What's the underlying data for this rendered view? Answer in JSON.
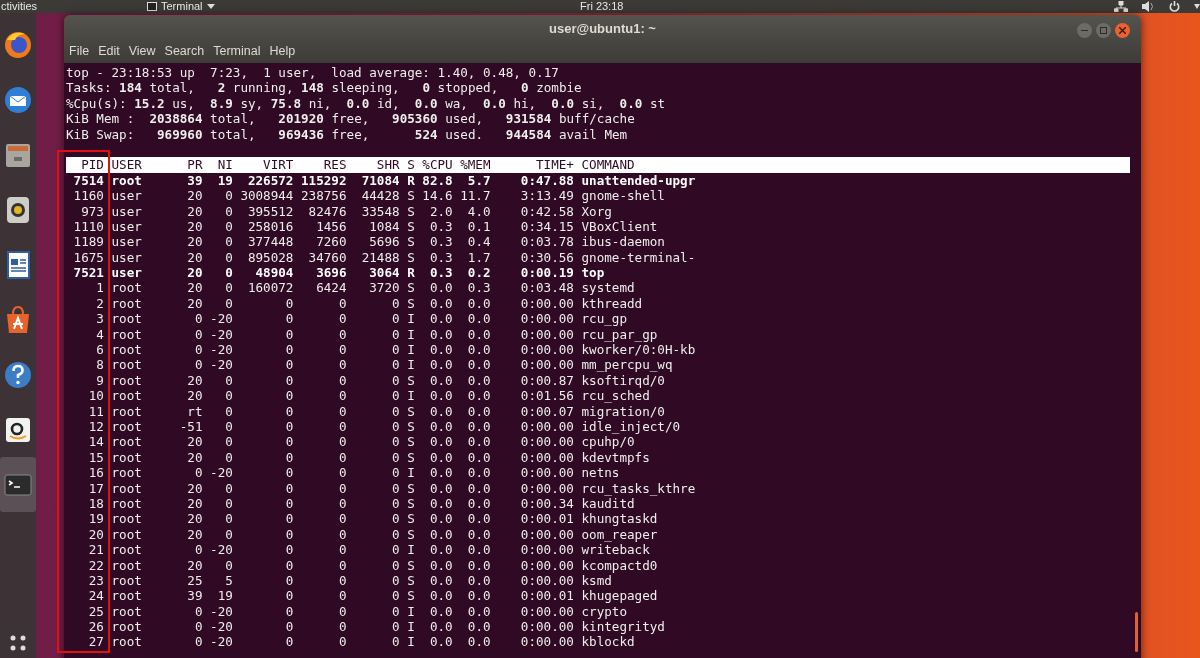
{
  "top_bar": {
    "activities": "ctivities",
    "app_menu": "Terminal",
    "clock": "Fri 23:18"
  },
  "dock": {
    "items": [
      {
        "kind": "browser",
        "selected": false
      },
      {
        "kind": "mail",
        "selected": false
      },
      {
        "kind": "files",
        "selected": false
      },
      {
        "kind": "music",
        "selected": false
      },
      {
        "kind": "writer",
        "selected": false
      },
      {
        "kind": "store",
        "selected": false
      },
      {
        "kind": "help",
        "selected": false
      },
      {
        "kind": "shop",
        "selected": false
      },
      {
        "kind": "terminal",
        "selected": true
      }
    ]
  },
  "window": {
    "title": "user@ubuntu1: ~",
    "menu": [
      "File",
      "Edit",
      "View",
      "Search",
      "Terminal",
      "Help"
    ]
  },
  "summary": [
    "top - 23:18:53 up  7:23,  1 user,  load average: 1.40, 0.48, 0.17",
    "Tasks: **184** total,   **2** running, **148** sleeping,   **0** stopped,   **0** zombie",
    "%Cpu(s): **15.2** us,  **8.9** sy, **75.8** ni,  **0.0** id,  **0.0** wa,  **0.0** hi,  **0.0** si,  **0.0** st",
    "KiB Mem :  **2038864** total,   **201920** free,   **905360** used,   **931584** buff/cache",
    "KiB Swap:   **969960** total,   **969436** free,      **524** used.   **944584** avail Mem"
  ],
  "table": {
    "columns": [
      "PID",
      "USER",
      "PR",
      "NI",
      "VIRT",
      "RES",
      "SHR",
      "S",
      "%CPU",
      "%MEM",
      "TIME+",
      "COMMAND"
    ],
    "rows": [
      {
        "highlighted": true,
        "cells": [
          "7514",
          "root",
          "39",
          "19",
          "226572",
          "115292",
          "71084",
          "R",
          "82.8",
          "5.7",
          "0:47.88",
          "unattended-upgr"
        ]
      },
      {
        "highlighted": false,
        "cells": [
          "1160",
          "user",
          "20",
          "0",
          "3008944",
          "238756",
          "44428",
          "S",
          "14.6",
          "11.7",
          "3:13.49",
          "gnome-shell"
        ]
      },
      {
        "highlighted": false,
        "cells": [
          "973",
          "user",
          "20",
          "0",
          "395512",
          "82476",
          "33548",
          "S",
          "2.0",
          "4.0",
          "0:42.58",
          "Xorg"
        ]
      },
      {
        "highlighted": false,
        "cells": [
          "1110",
          "user",
          "20",
          "0",
          "258016",
          "1456",
          "1084",
          "S",
          "0.3",
          "0.1",
          "0:34.15",
          "VBoxClient"
        ]
      },
      {
        "highlighted": false,
        "cells": [
          "1189",
          "user",
          "20",
          "0",
          "377448",
          "7260",
          "5696",
          "S",
          "0.3",
          "0.4",
          "0:03.78",
          "ibus-daemon"
        ]
      },
      {
        "highlighted": false,
        "cells": [
          "1675",
          "user",
          "20",
          "0",
          "895028",
          "34760",
          "21488",
          "S",
          "0.3",
          "1.7",
          "0:30.56",
          "gnome-terminal-"
        ]
      },
      {
        "highlighted": true,
        "cells": [
          "7521",
          "user",
          "20",
          "0",
          "48904",
          "3696",
          "3064",
          "R",
          "0.3",
          "0.2",
          "0:00.19",
          "top"
        ]
      },
      {
        "highlighted": false,
        "cells": [
          "1",
          "root",
          "20",
          "0",
          "160072",
          "6424",
          "3720",
          "S",
          "0.0",
          "0.3",
          "0:03.48",
          "systemd"
        ]
      },
      {
        "highlighted": false,
        "cells": [
          "2",
          "root",
          "20",
          "0",
          "0",
          "0",
          "0",
          "S",
          "0.0",
          "0.0",
          "0:00.00",
          "kthreadd"
        ]
      },
      {
        "highlighted": false,
        "cells": [
          "3",
          "root",
          "0",
          "-20",
          "0",
          "0",
          "0",
          "I",
          "0.0",
          "0.0",
          "0:00.00",
          "rcu_gp"
        ]
      },
      {
        "highlighted": false,
        "cells": [
          "4",
          "root",
          "0",
          "-20",
          "0",
          "0",
          "0",
          "I",
          "0.0",
          "0.0",
          "0:00.00",
          "rcu_par_gp"
        ]
      },
      {
        "highlighted": false,
        "cells": [
          "6",
          "root",
          "0",
          "-20",
          "0",
          "0",
          "0",
          "I",
          "0.0",
          "0.0",
          "0:00.00",
          "kworker/0:0H-kb"
        ]
      },
      {
        "highlighted": false,
        "cells": [
          "8",
          "root",
          "0",
          "-20",
          "0",
          "0",
          "0",
          "I",
          "0.0",
          "0.0",
          "0:00.00",
          "mm_percpu_wq"
        ]
      },
      {
        "highlighted": false,
        "cells": [
          "9",
          "root",
          "20",
          "0",
          "0",
          "0",
          "0",
          "S",
          "0.0",
          "0.0",
          "0:00.87",
          "ksoftirqd/0"
        ]
      },
      {
        "highlighted": false,
        "cells": [
          "10",
          "root",
          "20",
          "0",
          "0",
          "0",
          "0",
          "I",
          "0.0",
          "0.0",
          "0:01.56",
          "rcu_sched"
        ]
      },
      {
        "highlighted": false,
        "cells": [
          "11",
          "root",
          "rt",
          "0",
          "0",
          "0",
          "0",
          "S",
          "0.0",
          "0.0",
          "0:00.07",
          "migration/0"
        ]
      },
      {
        "highlighted": false,
        "cells": [
          "12",
          "root",
          "-51",
          "0",
          "0",
          "0",
          "0",
          "S",
          "0.0",
          "0.0",
          "0:00.00",
          "idle_inject/0"
        ]
      },
      {
        "highlighted": false,
        "cells": [
          "14",
          "root",
          "20",
          "0",
          "0",
          "0",
          "0",
          "S",
          "0.0",
          "0.0",
          "0:00.00",
          "cpuhp/0"
        ]
      },
      {
        "highlighted": false,
        "cells": [
          "15",
          "root",
          "20",
          "0",
          "0",
          "0",
          "0",
          "S",
          "0.0",
          "0.0",
          "0:00.00",
          "kdevtmpfs"
        ]
      },
      {
        "highlighted": false,
        "cells": [
          "16",
          "root",
          "0",
          "-20",
          "0",
          "0",
          "0",
          "I",
          "0.0",
          "0.0",
          "0:00.00",
          "netns"
        ]
      },
      {
        "highlighted": false,
        "cells": [
          "17",
          "root",
          "20",
          "0",
          "0",
          "0",
          "0",
          "S",
          "0.0",
          "0.0",
          "0:00.00",
          "rcu_tasks_kthre"
        ]
      },
      {
        "highlighted": false,
        "cells": [
          "18",
          "root",
          "20",
          "0",
          "0",
          "0",
          "0",
          "S",
          "0.0",
          "0.0",
          "0:00.34",
          "kauditd"
        ]
      },
      {
        "highlighted": false,
        "cells": [
          "19",
          "root",
          "20",
          "0",
          "0",
          "0",
          "0",
          "S",
          "0.0",
          "0.0",
          "0:00.01",
          "khungtaskd"
        ]
      },
      {
        "highlighted": false,
        "cells": [
          "20",
          "root",
          "20",
          "0",
          "0",
          "0",
          "0",
          "S",
          "0.0",
          "0.0",
          "0:00.00",
          "oom_reaper"
        ]
      },
      {
        "highlighted": false,
        "cells": [
          "21",
          "root",
          "0",
          "-20",
          "0",
          "0",
          "0",
          "I",
          "0.0",
          "0.0",
          "0:00.00",
          "writeback"
        ]
      },
      {
        "highlighted": false,
        "cells": [
          "22",
          "root",
          "20",
          "0",
          "0",
          "0",
          "0",
          "S",
          "0.0",
          "0.0",
          "0:00.00",
          "kcompactd0"
        ]
      },
      {
        "highlighted": false,
        "cells": [
          "23",
          "root",
          "25",
          "5",
          "0",
          "0",
          "0",
          "S",
          "0.0",
          "0.0",
          "0:00.00",
          "ksmd"
        ]
      },
      {
        "highlighted": false,
        "cells": [
          "24",
          "root",
          "39",
          "19",
          "0",
          "0",
          "0",
          "S",
          "0.0",
          "0.0",
          "0:00.01",
          "khugepaged"
        ]
      },
      {
        "highlighted": false,
        "cells": [
          "25",
          "root",
          "0",
          "-20",
          "0",
          "0",
          "0",
          "I",
          "0.0",
          "0.0",
          "0:00.00",
          "crypto"
        ]
      },
      {
        "highlighted": false,
        "cells": [
          "26",
          "root",
          "0",
          "-20",
          "0",
          "0",
          "0",
          "I",
          "0.0",
          "0.0",
          "0:00.00",
          "kintegrityd"
        ]
      },
      {
        "highlighted": false,
        "cells": [
          "27",
          "root",
          "0",
          "-20",
          "0",
          "0",
          "0",
          "I",
          "0.0",
          "0.0",
          "0:00.00",
          "kblockd"
        ]
      }
    ]
  }
}
